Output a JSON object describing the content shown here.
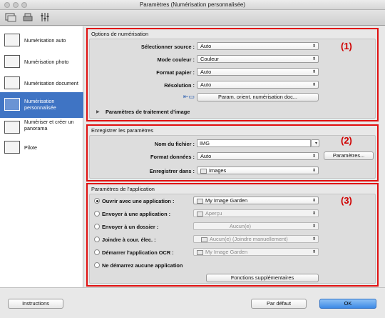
{
  "window": {
    "title": "Paramètres (Numérisation personnalisée)"
  },
  "toolbar": {
    "icons": [
      "scan-from-computer-icon",
      "scan-from-panel-icon",
      "general-settings-icon"
    ]
  },
  "sidebar": {
    "items": [
      {
        "label": "Numérisation auto"
      },
      {
        "label": "Numérisation photo"
      },
      {
        "label": "Numérisation document"
      },
      {
        "label": "Numérisation personnalisée",
        "selected": true
      },
      {
        "label": "Numériser et créer un panorama"
      },
      {
        "label": "Pilote"
      }
    ]
  },
  "scan_options": {
    "title": "Options de numérisation",
    "marker": "(1)",
    "source_label": "Sélectionner source :",
    "source_value": "Auto",
    "color_label": "Mode couleur :",
    "color_value": "Couleur",
    "paper_label": "Format papier :",
    "paper_value": "Auto",
    "resolution_label": "Résolution :",
    "resolution_value": "Auto",
    "orient_button": "Param. orient. numérisation doc...",
    "image_processing_label": "Paramètres de traitement d'image"
  },
  "save_settings": {
    "title": "Enregistrer les paramètres",
    "marker": "(2)",
    "filename_label": "Nom du fichier :",
    "filename_value": "IMG",
    "format_label": "Format données :",
    "format_value": "Auto",
    "settings_button": "Paramètres...",
    "save_in_label": "Enregistrer dans :",
    "save_in_value": "Images"
  },
  "app_settings": {
    "title": "Paramètres de l'application",
    "marker": "(3)",
    "options": [
      {
        "label": "Ouvrir avec une application :",
        "value": "My Image Garden",
        "selected": true,
        "enabled": true
      },
      {
        "label": "Envoyer à une application :",
        "value": "Aperçu",
        "selected": false,
        "enabled": false
      },
      {
        "label": "Envoyer à un dossier :",
        "value": "Aucun(e)",
        "selected": false,
        "enabled": false
      },
      {
        "label": "Joindre à cour. élec. :",
        "value": "Aucun(e) (Joindre manuellement)",
        "selected": false,
        "enabled": false
      },
      {
        "label": "Démarrer l'application OCR :",
        "value": "My Image Garden",
        "selected": false,
        "enabled": false
      },
      {
        "label": "Ne démarrez aucune application",
        "value": "",
        "selected": false,
        "enabled": false
      }
    ],
    "extra_button": "Fonctions supplémentaires"
  },
  "footer": {
    "instructions_button": "Instructions",
    "default_button": "Par défaut",
    "ok_button": "OK"
  }
}
